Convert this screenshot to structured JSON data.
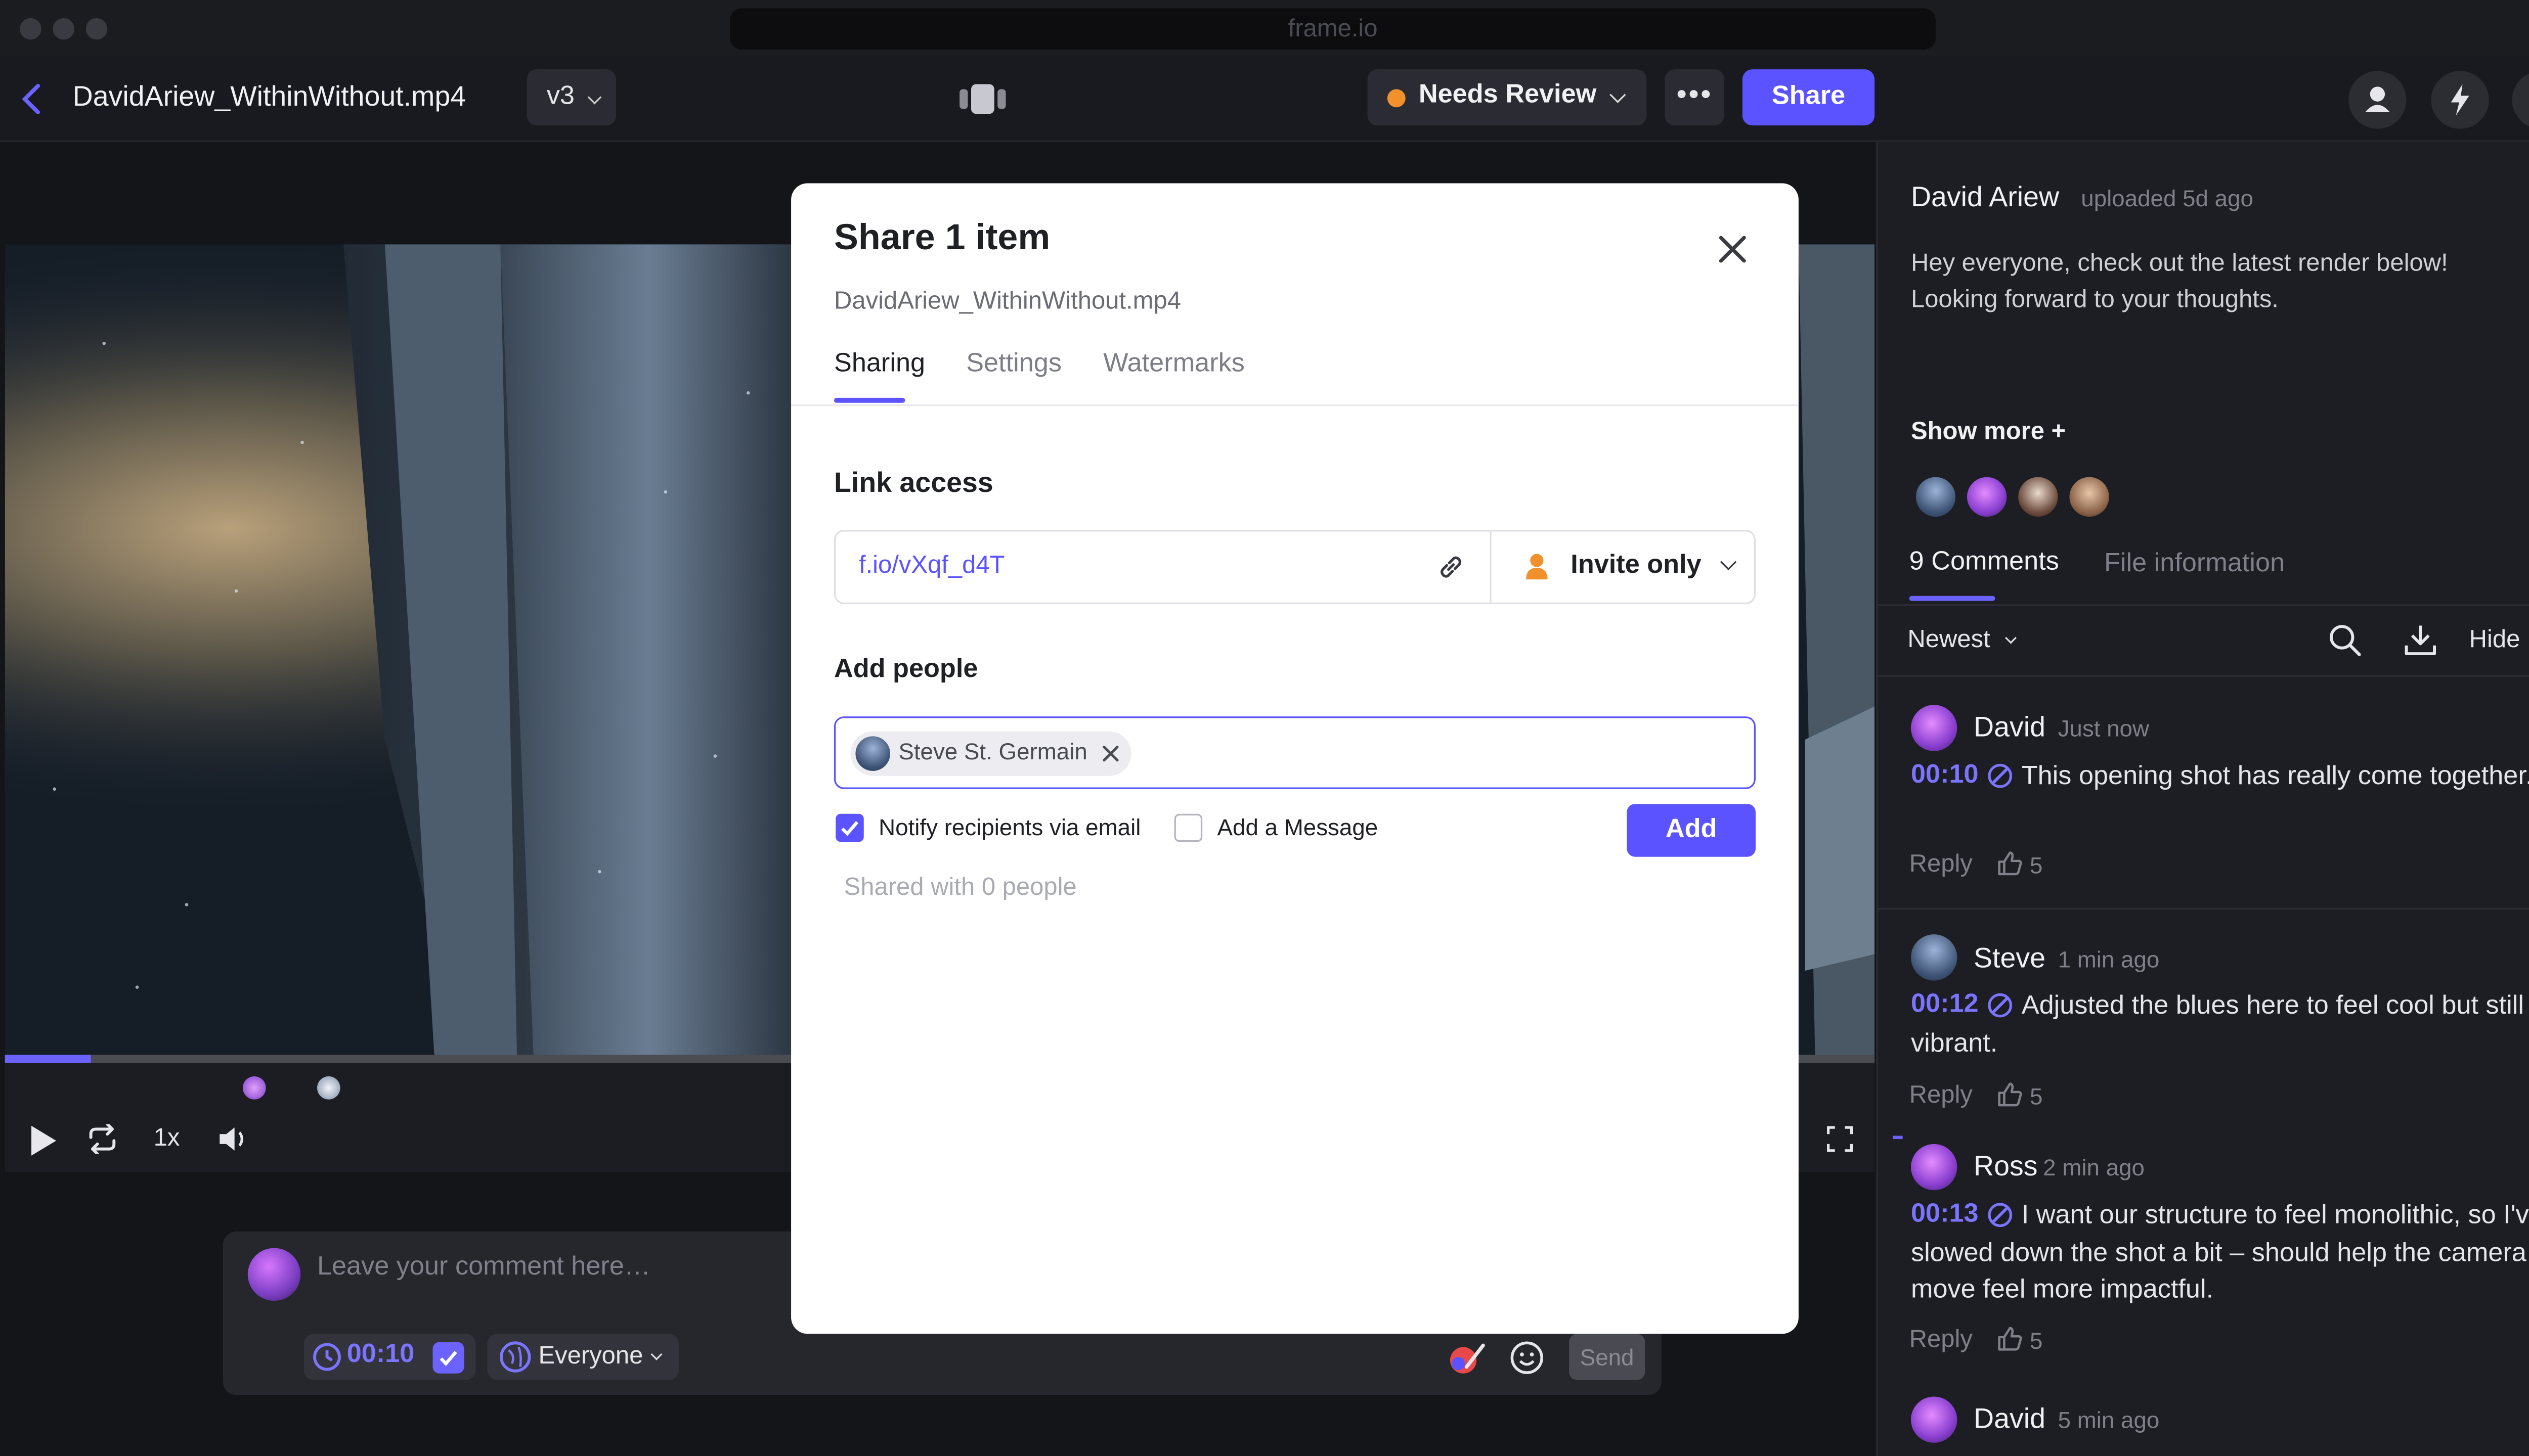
{
  "browser": {
    "url": "frame.io"
  },
  "topbar": {
    "file_title": "DavidAriew_WithinWithout.mp4",
    "version": "v3",
    "status": {
      "label": "Needs Review",
      "color": "#f2912b"
    },
    "more_label": "•••",
    "share_label": "Share",
    "help_label": "?"
  },
  "player": {
    "speed": "1x",
    "progress": 0.046,
    "markers": [
      {
        "time_fraction": 0.134,
        "color": "#c46bff"
      },
      {
        "time_fraction": 0.174,
        "color": "#d8e2f0"
      }
    ]
  },
  "composer": {
    "placeholder": "Leave your comment here…",
    "timecode": "00:10",
    "visibility": "Everyone",
    "send_label": "Send"
  },
  "panel": {
    "uploader": "David Ariew",
    "uploaded": "uploaded 5d ago",
    "description": "Hey everyone, check out the latest render below! Looking forward to your thoughts.",
    "show_more": "Show more +",
    "tabs": {
      "comments": "9 Comments",
      "file_info": "File information"
    },
    "sort": "Newest",
    "hide_label": "Hide",
    "comments": [
      {
        "author": "David",
        "time": "Just now",
        "timecode": "00:10",
        "text": "This opening shot has really come together.",
        "reply": "Reply",
        "likes": "5"
      },
      {
        "author": "Steve",
        "time": "1 min ago",
        "timecode": "00:12",
        "text": "Adjusted the blues here to feel cool but still vibrant.",
        "reply": "Reply",
        "likes": "5"
      },
      {
        "author": "Ross",
        "time": "2 min ago",
        "timecode": "00:13",
        "text": "I want our structure to feel monolithic, so I've slowed down the shot a bit – should help the camera move feel more impactful.",
        "reply": "Reply",
        "likes": "5"
      },
      {
        "author": "David",
        "time": "5 min ago"
      }
    ]
  },
  "modal": {
    "title": "Share 1 item",
    "file": "DavidAriew_WithinWithout.mp4",
    "tabs": {
      "sharing": "Sharing",
      "settings": "Settings",
      "watermarks": "Watermarks"
    },
    "link_access_heading": "Link access",
    "link_url": "f.io/vXqf_d4T",
    "access_level": "Invite only",
    "add_people_heading": "Add people",
    "recipient_chip": "Steve St. Germain",
    "notify_label": "Notify recipients via email",
    "notify_checked": true,
    "message_label": "Add a Message",
    "message_checked": false,
    "add_label": "Add",
    "shared_with": "Shared with 0 people"
  },
  "colors": {
    "accent": "#5b53ff",
    "timecode": "#7b74ff",
    "status_orange": "#f2912b"
  }
}
